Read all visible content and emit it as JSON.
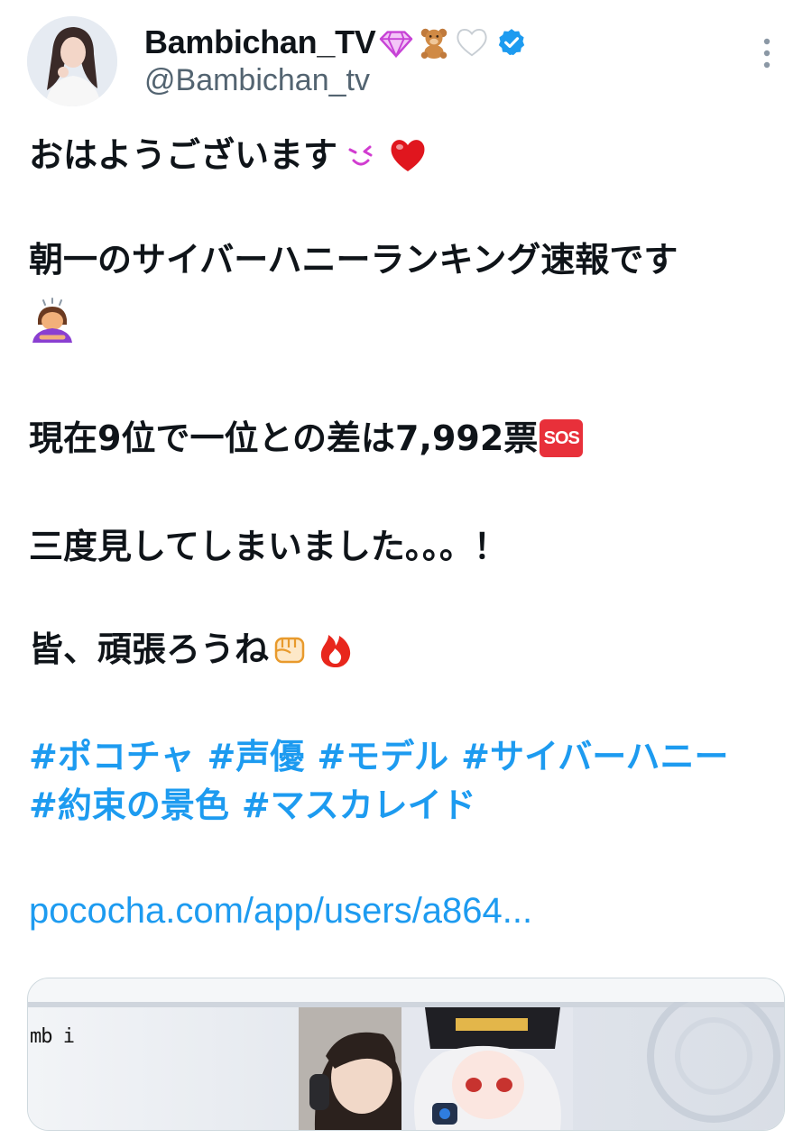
{
  "user": {
    "display_name": "Bambichan_TV",
    "name_emojis": [
      "gem-icon",
      "teddy-bear-icon",
      "white-heart-icon"
    ],
    "verified": true,
    "handle": "@Bambichan_tv"
  },
  "tweet": {
    "line1": "おはようございます",
    "line2": "朝一のサイバーハニーランキング速報です",
    "line3": "現在9位で一位との差は7,992票",
    "sos": "SOS",
    "line4": "三度見してしまいました。。。！",
    "line5": "皆、頑張ろうね",
    "hashtags": [
      "#ポコチャ",
      "#声優",
      "#モデル",
      "#サイバーハニー",
      "#約束の景色",
      "#マスカレイド"
    ],
    "link": "pococha.com/app/users/a864..."
  },
  "card": {
    "caption": "mb i"
  },
  "colors": {
    "link_blue": "#1d9bf0",
    "text": "#0f1419",
    "secondary": "#536471",
    "sos_red": "#e8303a"
  }
}
